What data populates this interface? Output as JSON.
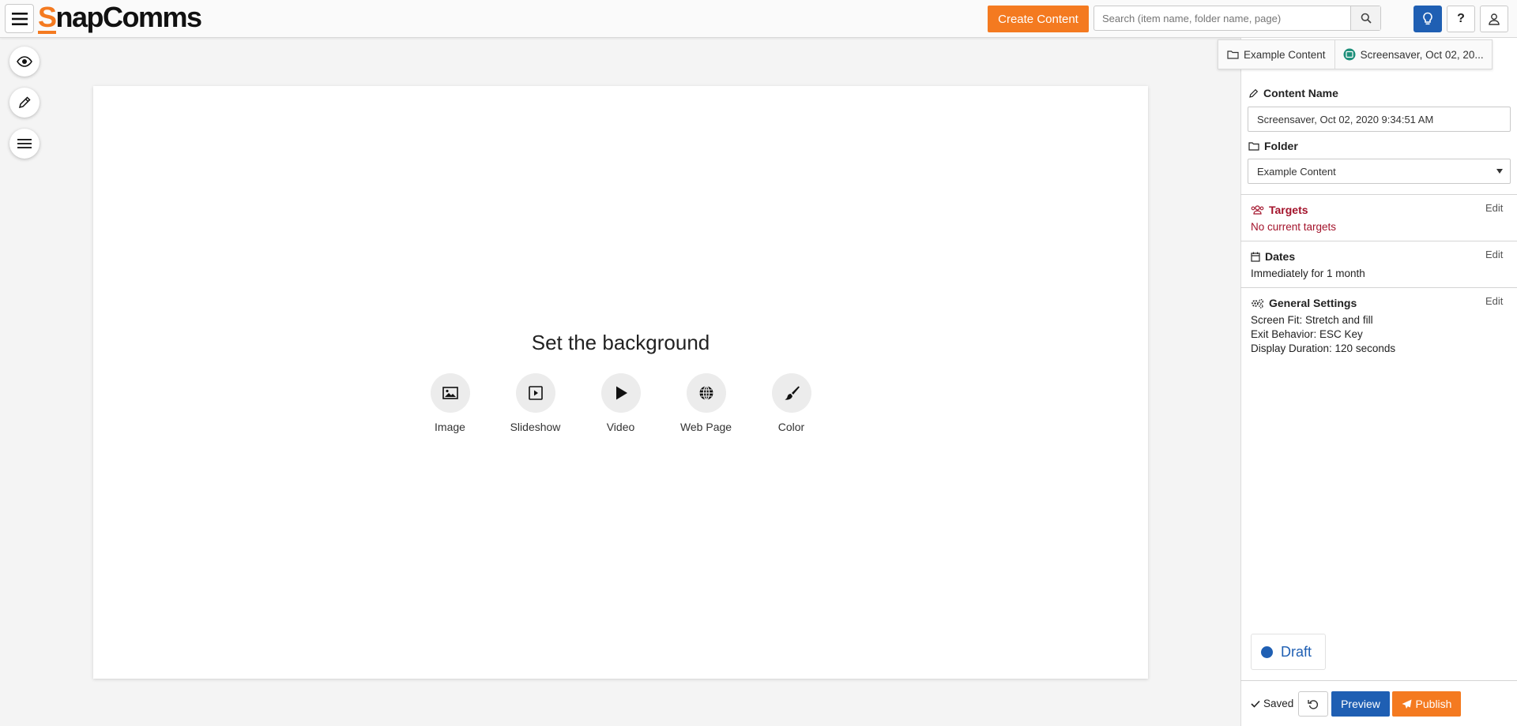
{
  "header": {
    "logo_first": "S",
    "logo_rest": "napComms",
    "create_label": "Create Content",
    "search_placeholder": "Search (item name, folder name, page)",
    "help_label": "?"
  },
  "canvas": {
    "title": "Set the background",
    "options": [
      {
        "label": "Image",
        "icon": "image-icon"
      },
      {
        "label": "Slideshow",
        "icon": "slideshow-icon"
      },
      {
        "label": "Video",
        "icon": "play-icon"
      },
      {
        "label": "Web Page",
        "icon": "globe-icon"
      },
      {
        "label": "Color",
        "icon": "brush-icon"
      }
    ]
  },
  "breadcrumb": {
    "folder": "Example Content",
    "item": "Screensaver, Oct 02, 20..."
  },
  "panel": {
    "content_name_label": "Content Name",
    "content_name_value": "Screensaver, Oct 02, 2020 9:34:51 AM",
    "folder_label": "Folder",
    "folder_value": "Example Content",
    "targets_title": "Targets",
    "targets_text": "No current targets",
    "dates_title": "Dates",
    "dates_text": "Immediately for 1 month",
    "general_title": "General Settings",
    "general_lines": [
      "Screen Fit: Stretch and fill",
      "Exit Behavior: ESC Key",
      "Display Duration: 120 seconds"
    ],
    "edit_label": "Edit",
    "status": "Draft"
  },
  "footer": {
    "saved_label": "Saved",
    "preview_label": "Preview",
    "publish_label": "Publish"
  },
  "colors": {
    "accent_orange": "#f47a20",
    "accent_blue": "#1f5fb3",
    "targets_red": "#a3132b"
  }
}
